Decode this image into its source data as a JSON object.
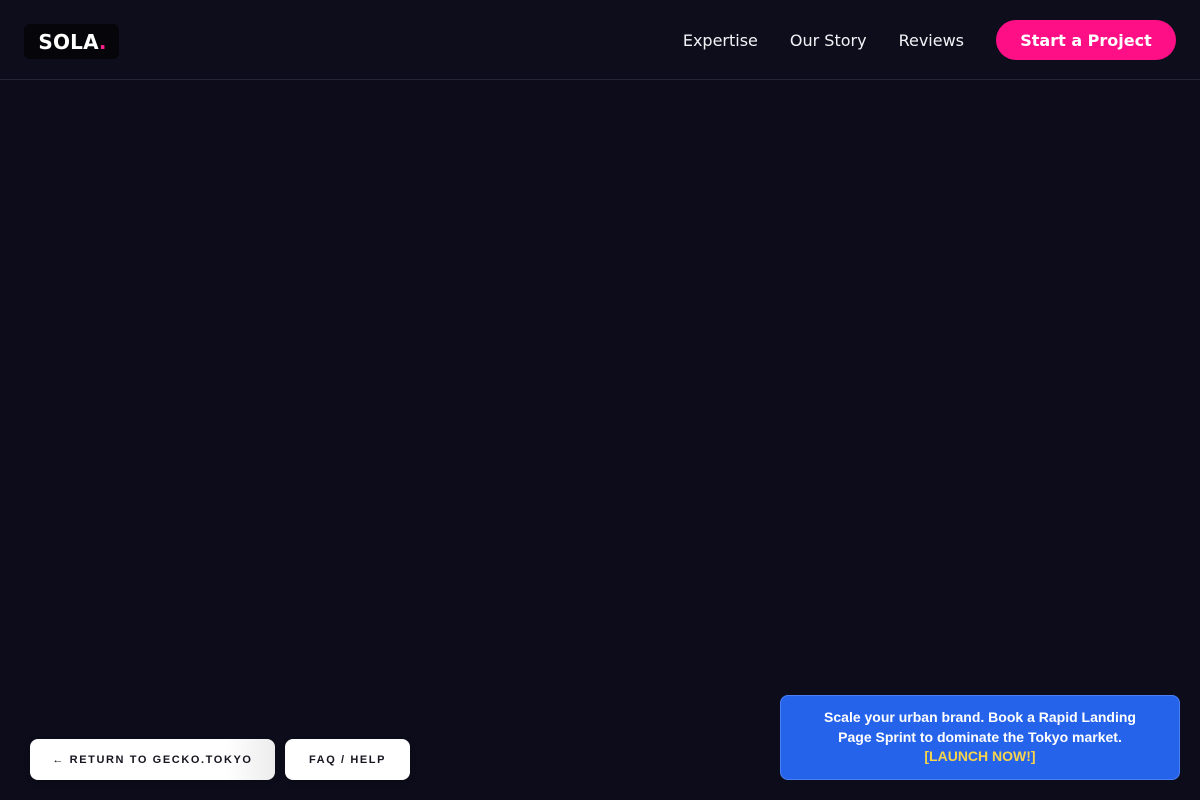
{
  "header": {
    "logo_text": "SOLA",
    "logo_dot": ".",
    "nav": [
      {
        "label": "Expertise"
      },
      {
        "label": "Our Story"
      },
      {
        "label": "Reviews"
      }
    ],
    "cta_label": "Start a Project"
  },
  "footer_buttons": {
    "return_label": "← RETURN TO GECKO.TOKYO",
    "faq_label": "FAQ / HELP"
  },
  "promo": {
    "text": "Scale your urban brand. Book a Rapid Landing Page Sprint to dominate the Tokyo market.",
    "link_label": "[LAUNCH NOW!]"
  },
  "colors": {
    "background": "#0d0c1b",
    "accent_pink": "#ff0f86",
    "promo_blue": "#2563eb",
    "promo_link_yellow": "#f7d44c"
  }
}
